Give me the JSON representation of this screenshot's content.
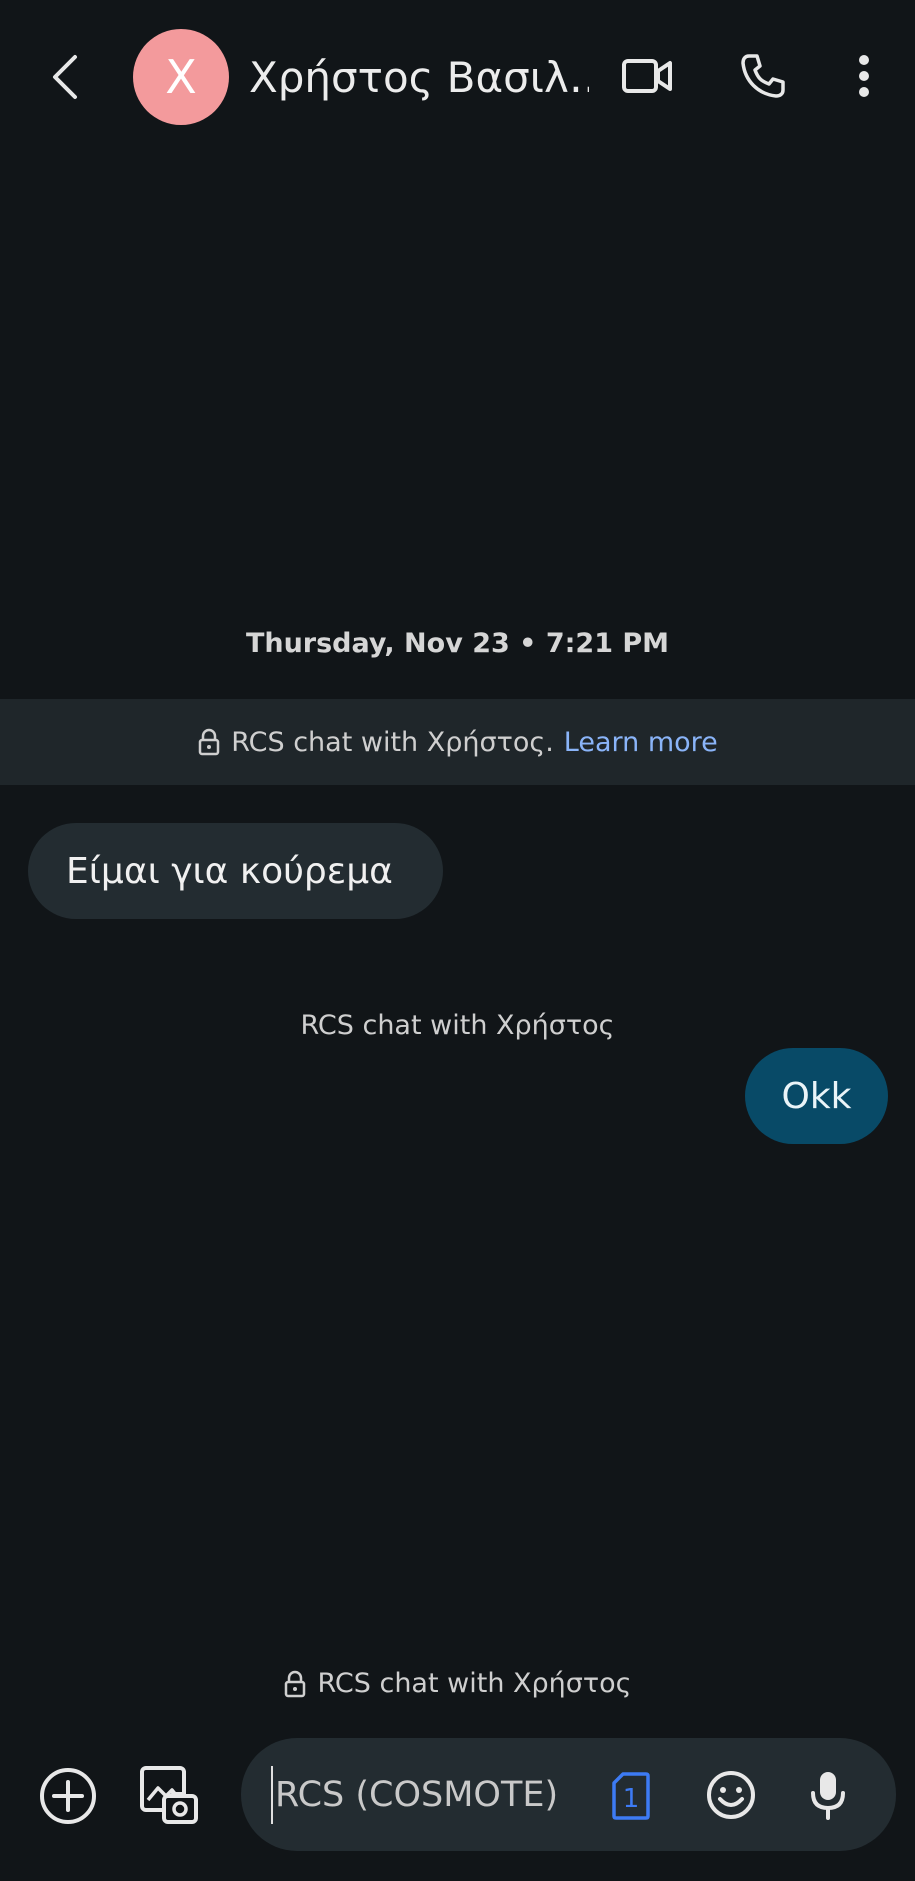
{
  "header": {
    "avatar_letter": "X",
    "contact_name": "Χρήστος Βασιλ…",
    "icons": [
      "back-arrow-icon",
      "video-call-icon",
      "phone-icon",
      "more-vert-icon"
    ]
  },
  "conversation": {
    "date_line": "Thursday, Nov 23 • 7:21 PM",
    "banner_text": "RCS chat with Χρήστος.",
    "banner_link": "Learn more",
    "messages": [
      {
        "direction": "incoming",
        "text": "Είμαι για κούρεμα"
      },
      {
        "direction": "outgoing",
        "text": "Okk"
      }
    ],
    "rcs_note": "RCS chat with Χρήστος",
    "rcs_bottom": "RCS chat with Χρήστος"
  },
  "compose": {
    "placeholder": "RCS (COSMOTE)",
    "sim_number": "1",
    "icons": [
      "add-circle-icon",
      "gallery-icon",
      "sim-icon",
      "emoji-icon",
      "mic-icon"
    ]
  },
  "colors": {
    "background": "#111518",
    "avatar": "#f39a9c",
    "incoming_bubble": "#232c31",
    "outgoing_bubble": "#084a67",
    "link": "#8ab4f8",
    "sim_accent": "#3d7bf4"
  }
}
